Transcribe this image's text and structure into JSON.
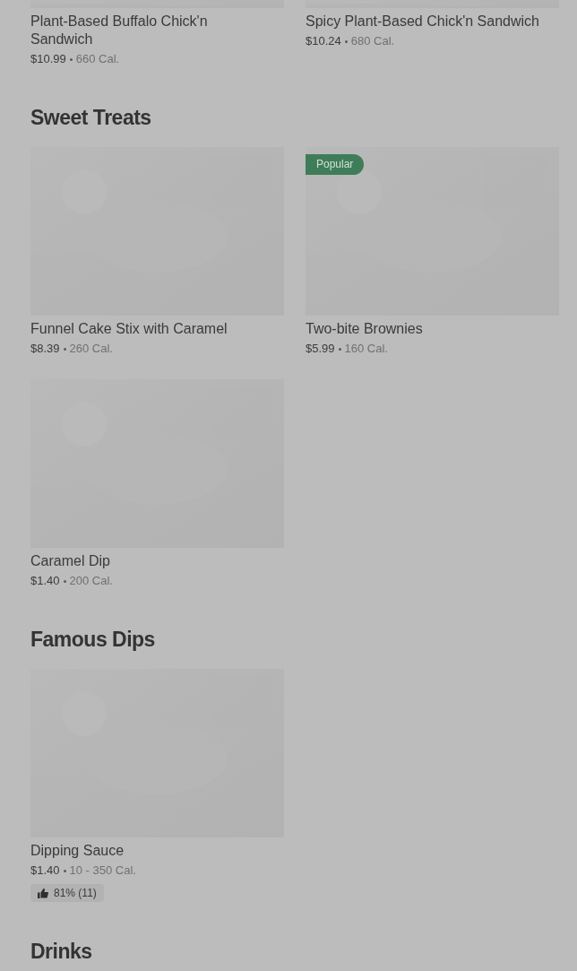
{
  "sections": [
    {
      "items": [
        {
          "name": "Plant-Based Buffalo Chick'n Sandwich",
          "price": "$10.99",
          "calories": "660 Cal."
        },
        {
          "name": "Spicy Plant-Based Chick'n Sandwich",
          "price": "$10.24",
          "calories": "680 Cal."
        }
      ]
    },
    {
      "title": "Sweet Treats",
      "items": [
        {
          "name": "Funnel Cake Stix with Caramel",
          "price": "$8.39",
          "calories": "260 Cal."
        },
        {
          "name": "Two-bite Brownies",
          "price": "$5.99",
          "calories": "160 Cal.",
          "badge": "Popular"
        },
        {
          "name": "Caramel Dip",
          "price": "$1.40",
          "calories": "200 Cal."
        }
      ]
    },
    {
      "title": "Famous Dips",
      "items": [
        {
          "name": "Dipping Sauce",
          "price": "$1.40",
          "calories": "10 - 350 Cal.",
          "rating": "81% (11)"
        }
      ]
    },
    {
      "title": "Drinks"
    }
  ]
}
